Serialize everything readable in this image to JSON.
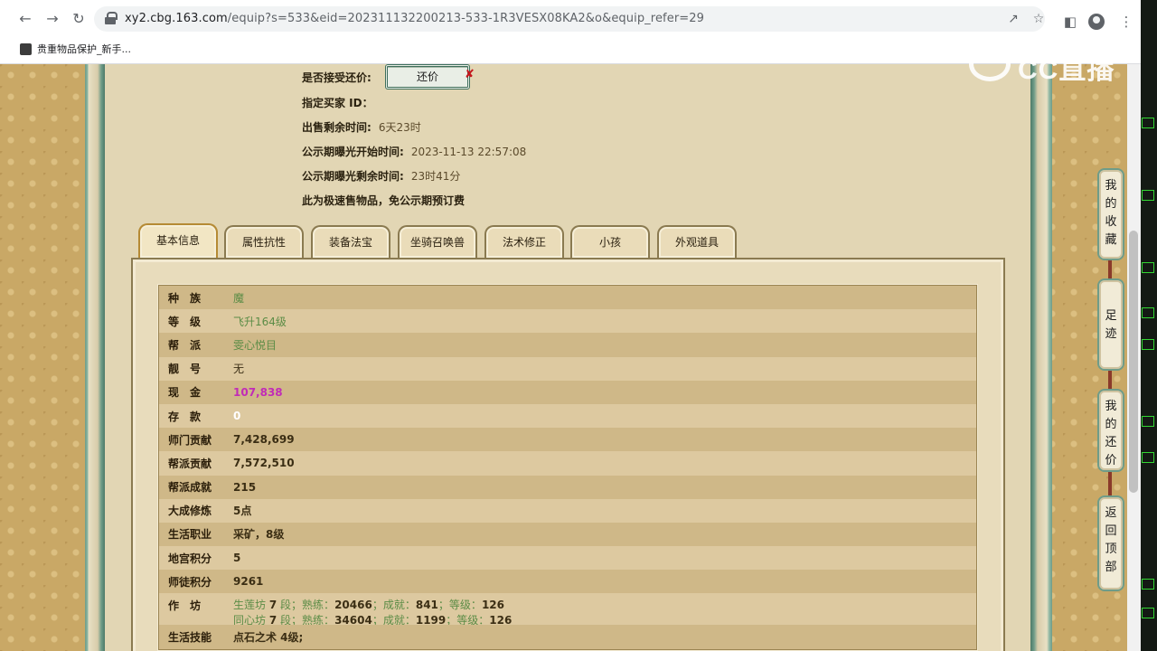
{
  "browser": {
    "url_host": "xy2.cbg.163.com",
    "url_rest": "/equip?s=533&eid=202311132200213-533-1R3VESX08KA2&o&equip_refer=29",
    "bookmark": "贵重物品保护_新手..."
  },
  "info": {
    "accept_counter_label": "是否接受还价:",
    "counter_button": "还价",
    "buyer_id_label": "指定买家 ID：",
    "remain_label": "出售剩余时间:",
    "remain_value": "6天23时",
    "publicity_start_label": "公示期曝光开始时间:",
    "publicity_start_value": "2023-11-13 22:57:08",
    "publicity_remain_label": "公示期曝光剩余时间:",
    "publicity_remain_value": "23时41分",
    "fast_sale_note": "此为极速售物品，免公示期预订费"
  },
  "tabs": [
    "基本信息",
    "属性抗性",
    "装备法宝",
    "坐骑召唤兽",
    "法术修正",
    "小孩",
    "外观道具"
  ],
  "rows": [
    {
      "k": "种族",
      "v": "魔"
    },
    {
      "k": "等级",
      "v": "飞升164级"
    },
    {
      "k": "帮派",
      "v": "雯心悦目"
    },
    {
      "k": "靓号",
      "v": "无"
    },
    {
      "k": "现金",
      "v": "107,838"
    },
    {
      "k": "存款",
      "v": "0"
    },
    {
      "k": "师门贡献",
      "v": "7,428,699"
    },
    {
      "k": "帮派贡献",
      "v": "7,572,510"
    },
    {
      "k": "帮派成就",
      "v": "215"
    },
    {
      "k": "大成修炼",
      "v": "5点"
    },
    {
      "k": "生活职业",
      "v": "采矿，8级"
    },
    {
      "k": "地宫积分",
      "v": "5"
    },
    {
      "k": "师徒积分",
      "v": "9261"
    },
    {
      "k": "作坊",
      "v": ""
    },
    {
      "k": "生活技能",
      "v": "点石之术 4级;"
    }
  ],
  "workshop": [
    {
      "name": "生莲坊",
      "stage": "7",
      "skill": "20466",
      "achv": "841",
      "lvl": "126"
    },
    {
      "name": "同心坊",
      "stage": "7",
      "skill": "34604",
      "achv": "1199",
      "lvl": "126"
    }
  ],
  "workshop_words": {
    "stage_unit": "段；",
    "skill": "熟练：",
    "achv": "成就：",
    "lvl": "等级："
  },
  "side": {
    "fav": [
      "我",
      "的",
      "收",
      "藏"
    ],
    "trace": [
      "足",
      "迹"
    ],
    "mycounter": [
      "我",
      "的",
      "还",
      "价"
    ],
    "top": [
      "返",
      "回",
      "顶",
      "部"
    ]
  },
  "watermark": "CC直播"
}
